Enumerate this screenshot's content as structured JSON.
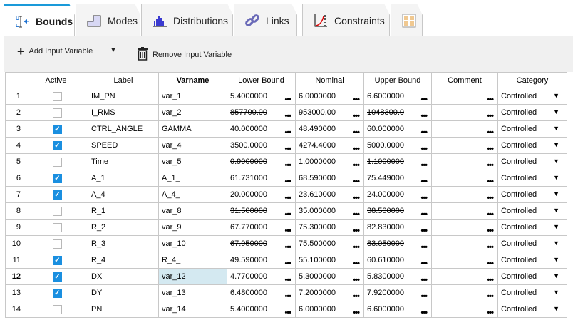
{
  "tabs": [
    {
      "label": "Bounds",
      "icon": "bounds-icon",
      "active": true
    },
    {
      "label": "Modes",
      "icon": "modes-icon"
    },
    {
      "label": "Distributions",
      "icon": "distributions-icon"
    },
    {
      "label": "Links",
      "icon": "links-icon"
    },
    {
      "label": "Constraints",
      "icon": "constraints-icon"
    },
    {
      "label": "",
      "icon": "layout-grid-icon"
    }
  ],
  "toolbar": {
    "add_label": "Add Input Variable",
    "remove_label": "Remove Input Variable"
  },
  "columns": [
    "",
    "Active",
    "Label",
    "Varname",
    "Lower Bound",
    "Nominal",
    "Upper Bound",
    "Comment",
    "Category"
  ],
  "selected_row": 12,
  "rows": [
    {
      "n": "1",
      "active": false,
      "label": "IM_PN",
      "varname": "var_1",
      "lower": "5.4000000",
      "nominal": "6.0000000",
      "upper": "6.6000000",
      "comment": "",
      "category": "Controlled"
    },
    {
      "n": "2",
      "active": false,
      "label": "I_RMS",
      "varname": "var_2",
      "lower": "857700.00",
      "nominal": "953000.00",
      "upper": "1048300.0",
      "comment": "",
      "category": "Controlled"
    },
    {
      "n": "3",
      "active": true,
      "label": "CTRL_ANGLE",
      "varname": "GAMMA",
      "lower": "40.000000",
      "nominal": "48.490000",
      "upper": "60.000000",
      "comment": "",
      "category": "Controlled"
    },
    {
      "n": "4",
      "active": true,
      "label": "SPEED",
      "varname": "var_4",
      "lower": "3500.0000",
      "nominal": "4274.4000",
      "upper": "5000.0000",
      "comment": "",
      "category": "Controlled"
    },
    {
      "n": "5",
      "active": false,
      "label": "Time",
      "varname": "var_5",
      "lower": "0.9000000",
      "nominal": "1.0000000",
      "upper": "1.1000000",
      "comment": "",
      "category": "Controlled"
    },
    {
      "n": "6",
      "active": true,
      "label": "A_1",
      "varname": "A_1_",
      "lower": "61.731000",
      "nominal": "68.590000",
      "upper": "75.449000",
      "comment": "",
      "category": "Controlled"
    },
    {
      "n": "7",
      "active": true,
      "label": "A_4",
      "varname": "A_4_",
      "lower": "20.000000",
      "nominal": "23.610000",
      "upper": "24.000000",
      "comment": "",
      "category": "Controlled"
    },
    {
      "n": "8",
      "active": false,
      "label": "R_1",
      "varname": "var_8",
      "lower": "31.500000",
      "nominal": "35.000000",
      "upper": "38.500000",
      "comment": "",
      "category": "Controlled"
    },
    {
      "n": "9",
      "active": false,
      "label": "R_2",
      "varname": "var_9",
      "lower": "67.770000",
      "nominal": "75.300000",
      "upper": "82.830000",
      "comment": "",
      "category": "Controlled"
    },
    {
      "n": "10",
      "active": false,
      "label": "R_3",
      "varname": "var_10",
      "lower": "67.950000",
      "nominal": "75.500000",
      "upper": "83.050000",
      "comment": "",
      "category": "Controlled"
    },
    {
      "n": "11",
      "active": true,
      "label": "R_4",
      "varname": "R_4_",
      "lower": "49.590000",
      "nominal": "55.100000",
      "upper": "60.610000",
      "comment": "",
      "category": "Controlled"
    },
    {
      "n": "12",
      "active": true,
      "label": "DX",
      "varname": "var_12",
      "lower": "4.7700000",
      "nominal": "5.3000000",
      "upper": "5.8300000",
      "comment": "",
      "category": "Controlled"
    },
    {
      "n": "13",
      "active": true,
      "label": "DY",
      "varname": "var_13",
      "lower": "6.4800000",
      "nominal": "7.2000000",
      "upper": "7.9200000",
      "comment": "",
      "category": "Controlled"
    },
    {
      "n": "14",
      "active": false,
      "label": "PN",
      "varname": "var_14",
      "lower": "5.4000000",
      "nominal": "6.0000000",
      "upper": "6.6000000",
      "comment": "",
      "category": "Controlled"
    }
  ]
}
